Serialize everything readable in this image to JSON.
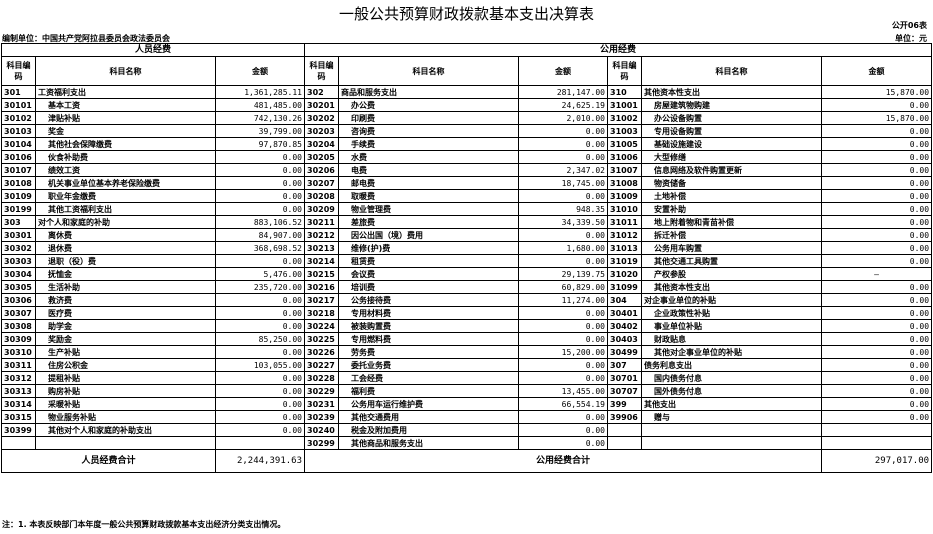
{
  "title": "一般公共预算财政拨款基本支出决算表",
  "form_code": "公开06表",
  "unit_left": "编制单位：中国共产党阿拉县委员会政法委员会",
  "unit_right": "单位：元",
  "section_personnel": "人员经费",
  "section_public": "公用经费",
  "headers": {
    "code": "科目编码",
    "name": "科目名称",
    "amount": "金额"
  },
  "rows": [
    {
      "c1": "301",
      "n1": "工资福利支出",
      "a1": "1,361,285.11",
      "c2": "302",
      "n2": "商品和服务支出",
      "a2": "281,147.00",
      "c3": "310",
      "n3": "其他资本性支出",
      "a3": "15,870.00"
    },
    {
      "c1": "30101",
      "n1": "基本工资",
      "a1": "481,485.00",
      "c2": "30201",
      "n2": "办公费",
      "a2": "24,625.19",
      "c3": "31001",
      "n3": "房屋建筑物购建",
      "a3": "0.00"
    },
    {
      "c1": "30102",
      "n1": "津贴补贴",
      "a1": "742,130.26",
      "c2": "30202",
      "n2": "印刷费",
      "a2": "2,010.00",
      "c3": "31002",
      "n3": "办公设备购置",
      "a3": "15,870.00"
    },
    {
      "c1": "30103",
      "n1": "奖金",
      "a1": "39,799.00",
      "c2": "30203",
      "n2": "咨询费",
      "a2": "0.00",
      "c3": "31003",
      "n3": "专用设备购置",
      "a3": "0.00"
    },
    {
      "c1": "30104",
      "n1": "其他社会保障缴费",
      "a1": "97,870.85",
      "c2": "30204",
      "n2": "手续费",
      "a2": "0.00",
      "c3": "31005",
      "n3": "基础设施建设",
      "a3": "0.00"
    },
    {
      "c1": "30106",
      "n1": "伙食补助费",
      "a1": "0.00",
      "c2": "30205",
      "n2": "水费",
      "a2": "0.00",
      "c3": "31006",
      "n3": "大型修缮",
      "a3": "0.00"
    },
    {
      "c1": "30107",
      "n1": "绩效工资",
      "a1": "0.00",
      "c2": "30206",
      "n2": "电费",
      "a2": "2,347.02",
      "c3": "31007",
      "n3": "信息网络及软件购置更新",
      "a3": "0.00"
    },
    {
      "c1": "30108",
      "n1": "机关事业单位基本养老保险缴费",
      "a1": "0.00",
      "c2": "30207",
      "n2": "邮电费",
      "a2": "18,745.00",
      "c3": "31008",
      "n3": "物资储备",
      "a3": "0.00"
    },
    {
      "c1": "30109",
      "n1": "职业年金缴费",
      "a1": "0.00",
      "c2": "30208",
      "n2": "取暖费",
      "a2": "0.00",
      "c3": "31009",
      "n3": "土地补偿",
      "a3": "0.00"
    },
    {
      "c1": "30199",
      "n1": "其他工资福利支出",
      "a1": "0.00",
      "c2": "30209",
      "n2": "物业管理费",
      "a2": "948.35",
      "c3": "31010",
      "n3": "安置补助",
      "a3": "0.00"
    },
    {
      "c1": "303",
      "n1": "对个人和家庭的补助",
      "a1": "883,106.52",
      "c2": "30211",
      "n2": "差旅费",
      "a2": "34,339.50",
      "c3": "31011",
      "n3": "地上附着物和青苗补偿",
      "a3": "0.00"
    },
    {
      "c1": "30301",
      "n1": "离休费",
      "a1": "84,907.00",
      "c2": "30212",
      "n2": "因公出国（境）费用",
      "a2": "0.00",
      "c3": "31012",
      "n3": "拆迁补偿",
      "a3": "0.00"
    },
    {
      "c1": "30302",
      "n1": "退休费",
      "a1": "368,698.52",
      "c2": "30213",
      "n2": "维修(护)费",
      "a2": "1,680.00",
      "c3": "31013",
      "n3": "公务用车购置",
      "a3": "0.00"
    },
    {
      "c1": "30303",
      "n1": "退职（役）费",
      "a1": "0.00",
      "c2": "30214",
      "n2": "租赁费",
      "a2": "0.00",
      "c3": "31019",
      "n3": "其他交通工具购置",
      "a3": "0.00"
    },
    {
      "c1": "30304",
      "n1": "抚恤金",
      "a1": "5,476.00",
      "c2": "30215",
      "n2": "会议费",
      "a2": "29,139.75",
      "c3": "31020",
      "n3": "产权参股",
      "a3": "—"
    },
    {
      "c1": "30305",
      "n1": "生活补助",
      "a1": "235,720.00",
      "c2": "30216",
      "n2": "培训费",
      "a2": "60,829.00",
      "c3": "31099",
      "n3": "其他资本性支出",
      "a3": "0.00"
    },
    {
      "c1": "30306",
      "n1": "救济费",
      "a1": "0.00",
      "c2": "30217",
      "n2": "公务接待费",
      "a2": "11,274.00",
      "c3": "304",
      "n3": "对企事业单位的补贴",
      "a3": "0.00"
    },
    {
      "c1": "30307",
      "n1": "医疗费",
      "a1": "0.00",
      "c2": "30218",
      "n2": "专用材料费",
      "a2": "0.00",
      "c3": "30401",
      "n3": "企业政策性补贴",
      "a3": "0.00"
    },
    {
      "c1": "30308",
      "n1": "助学金",
      "a1": "0.00",
      "c2": "30224",
      "n2": "被装购置费",
      "a2": "0.00",
      "c3": "30402",
      "n3": "事业单位补贴",
      "a3": "0.00"
    },
    {
      "c1": "30309",
      "n1": "奖励金",
      "a1": "85,250.00",
      "c2": "30225",
      "n2": "专用燃料费",
      "a2": "0.00",
      "c3": "30403",
      "n3": "财政贴息",
      "a3": "0.00"
    },
    {
      "c1": "30310",
      "n1": "生产补贴",
      "a1": "0.00",
      "c2": "30226",
      "n2": "劳务费",
      "a2": "15,200.00",
      "c3": "30499",
      "n3": "其他对企事业单位的补贴",
      "a3": "0.00"
    },
    {
      "c1": "30311",
      "n1": "住房公积金",
      "a1": "103,055.00",
      "c2": "30227",
      "n2": "委托业务费",
      "a2": "0.00",
      "c3": "307",
      "n3": "债务利息支出",
      "a3": "0.00"
    },
    {
      "c1": "30312",
      "n1": "提租补贴",
      "a1": "0.00",
      "c2": "30228",
      "n2": "工会经费",
      "a2": "0.00",
      "c3": "30701",
      "n3": "国内债务付息",
      "a3": "0.00"
    },
    {
      "c1": "30313",
      "n1": "购房补贴",
      "a1": "0.00",
      "c2": "30229",
      "n2": "福利费",
      "a2": "13,455.00",
      "c3": "30707",
      "n3": "国外债务付息",
      "a3": "0.00"
    },
    {
      "c1": "30314",
      "n1": "采暖补贴",
      "a1": "0.00",
      "c2": "30231",
      "n2": "公务用车运行维护费",
      "a2": "66,554.19",
      "c3": "399",
      "n3": "其他支出",
      "a3": "0.00"
    },
    {
      "c1": "30315",
      "n1": "物业服务补贴",
      "a1": "0.00",
      "c2": "30239",
      "n2": "其他交通费用",
      "a2": "0.00",
      "c3": "39906",
      "n3": "赠与",
      "a3": "0.00"
    },
    {
      "c1": "30399",
      "n1": "其他对个人和家庭的补助支出",
      "a1": "0.00",
      "c2": "30240",
      "n2": "税金及附加费用",
      "a2": "0.00",
      "c3": "",
      "n3": "",
      "a3": ""
    },
    {
      "c1": "",
      "n1": "",
      "a1": "",
      "c2": "30299",
      "n2": "其他商品和服务支出",
      "a2": "0.00",
      "c3": "",
      "n3": "",
      "a3": ""
    }
  ],
  "totals": {
    "personnel_label": "人员经费合计",
    "personnel_value": "2,244,391.63",
    "public_label": "公用经费合计",
    "public_value": "297,017.00"
  },
  "note": "注：1. 本表反映部门本年度一般公共预算财政拨款基本支出经济分类支出情况。"
}
